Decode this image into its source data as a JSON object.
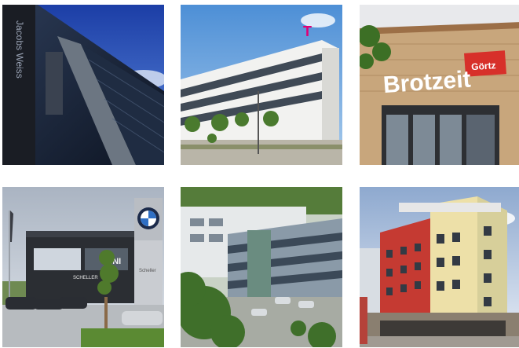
{
  "gallery": {
    "tiles": [
      {
        "sign": "Jacobs Weiss"
      },
      {
        "sign": "T"
      },
      {
        "sign": "Brotzeit",
        "sign_secondary": "Görtz"
      },
      {
        "sign": "MINI",
        "sign_secondary": "SCHELLER",
        "sign_tertiary": "Scheller"
      },
      {
        "sign": ""
      },
      {
        "sign": ""
      }
    ]
  }
}
